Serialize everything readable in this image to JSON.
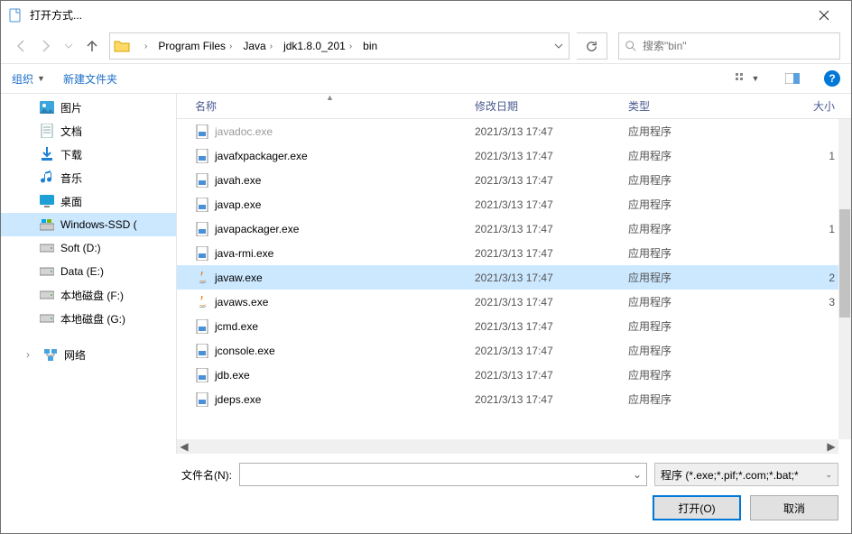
{
  "titlebar": {
    "title": "打开方式..."
  },
  "breadcrumbs": [
    "Program Files",
    "Java",
    "jdk1.8.0_201",
    "bin"
  ],
  "search": {
    "placeholder": "搜索\"bin\""
  },
  "toolbar": {
    "organize": "组织",
    "new_folder": "新建文件夹"
  },
  "tree": {
    "items": [
      {
        "label": "图片",
        "icon": "pictures",
        "indent": 1
      },
      {
        "label": "文档",
        "icon": "documents",
        "indent": 1
      },
      {
        "label": "下载",
        "icon": "downloads",
        "indent": 1
      },
      {
        "label": "音乐",
        "icon": "music",
        "indent": 1
      },
      {
        "label": "桌面",
        "icon": "desktop",
        "indent": 1
      },
      {
        "label": "Windows-SSD (",
        "icon": "drive-win",
        "indent": 1,
        "selected": true
      },
      {
        "label": "Soft (D:)",
        "icon": "drive",
        "indent": 1
      },
      {
        "label": "Data (E:)",
        "icon": "drive",
        "indent": 1
      },
      {
        "label": "本地磁盘 (F:)",
        "icon": "drive",
        "indent": 1
      },
      {
        "label": "本地磁盘 (G:)",
        "icon": "drive",
        "indent": 1
      }
    ],
    "network": "网络"
  },
  "columns": {
    "name": "名称",
    "date": "修改日期",
    "type": "类型",
    "size": "大小"
  },
  "files": [
    {
      "name": "javadoc.exe",
      "date": "2021/3/13 17:47",
      "type": "应用程序",
      "size": "",
      "icon": "app",
      "faded": true
    },
    {
      "name": "javafxpackager.exe",
      "date": "2021/3/13 17:47",
      "type": "应用程序",
      "size": "1",
      "icon": "app"
    },
    {
      "name": "javah.exe",
      "date": "2021/3/13 17:47",
      "type": "应用程序",
      "size": "",
      "icon": "app"
    },
    {
      "name": "javap.exe",
      "date": "2021/3/13 17:47",
      "type": "应用程序",
      "size": "",
      "icon": "app"
    },
    {
      "name": "javapackager.exe",
      "date": "2021/3/13 17:47",
      "type": "应用程序",
      "size": "1",
      "icon": "app"
    },
    {
      "name": "java-rmi.exe",
      "date": "2021/3/13 17:47",
      "type": "应用程序",
      "size": "",
      "icon": "app"
    },
    {
      "name": "javaw.exe",
      "date": "2021/3/13 17:47",
      "type": "应用程序",
      "size": "2",
      "icon": "java",
      "selected": true
    },
    {
      "name": "javaws.exe",
      "date": "2021/3/13 17:47",
      "type": "应用程序",
      "size": "3",
      "icon": "java"
    },
    {
      "name": "jcmd.exe",
      "date": "2021/3/13 17:47",
      "type": "应用程序",
      "size": "",
      "icon": "app"
    },
    {
      "name": "jconsole.exe",
      "date": "2021/3/13 17:47",
      "type": "应用程序",
      "size": "",
      "icon": "app"
    },
    {
      "name": "jdb.exe",
      "date": "2021/3/13 17:47",
      "type": "应用程序",
      "size": "",
      "icon": "app"
    },
    {
      "name": "jdeps.exe",
      "date": "2021/3/13 17:47",
      "type": "应用程序",
      "size": "",
      "icon": "app"
    }
  ],
  "footer": {
    "filename_label": "文件名(N):",
    "filename_value": "",
    "filter": "程序 (*.exe;*.pif;*.com;*.bat;*",
    "open": "打开(O)",
    "cancel": "取消"
  }
}
